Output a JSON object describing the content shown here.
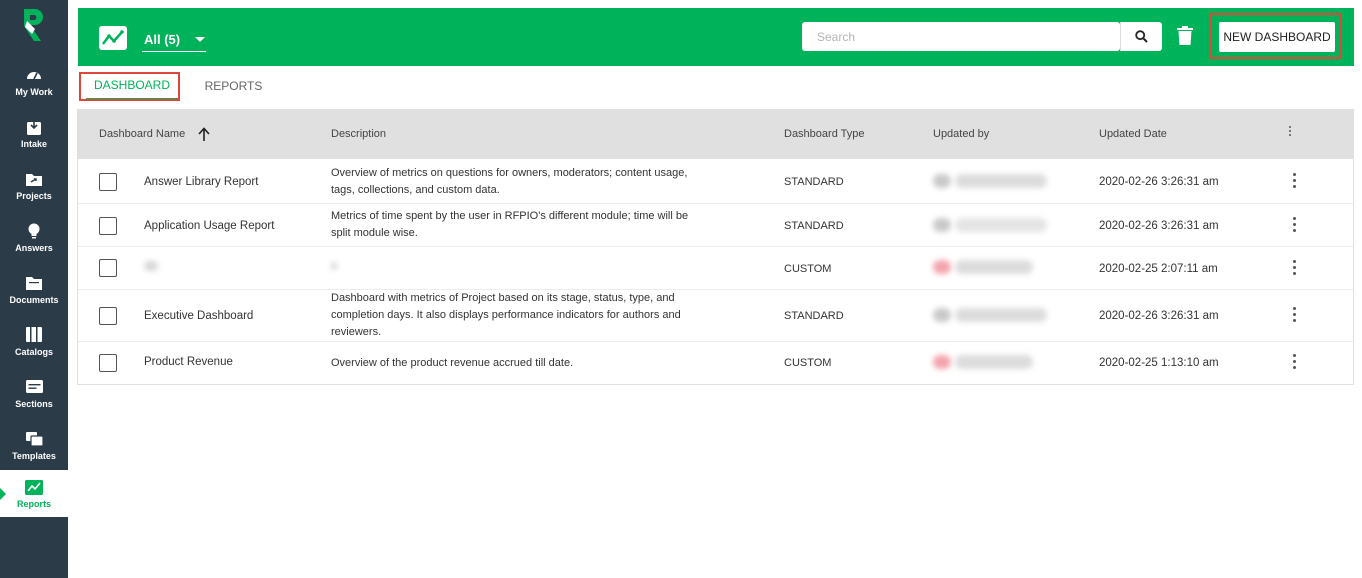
{
  "sidebar": {
    "items": [
      {
        "label": "My Work",
        "icon": "gauge-icon"
      },
      {
        "label": "Intake",
        "icon": "inbox-download-icon"
      },
      {
        "label": "Projects",
        "icon": "folder-share-icon"
      },
      {
        "label": "Answers",
        "icon": "lightbulb-icon"
      },
      {
        "label": "Documents",
        "icon": "folder-icon"
      },
      {
        "label": "Catalogs",
        "icon": "book-icon"
      },
      {
        "label": "Sections",
        "icon": "sections-icon"
      },
      {
        "label": "Templates",
        "icon": "templates-icon"
      },
      {
        "label": "Reports",
        "icon": "chart-line-icon"
      }
    ],
    "active": "Reports"
  },
  "header": {
    "filter_label": "All (5)",
    "search_placeholder": "Search",
    "new_button_label": "NEW DASHBOARD"
  },
  "tabs": [
    {
      "label": "DASHBOARD",
      "active": true
    },
    {
      "label": "REPORTS",
      "active": false
    }
  ],
  "table": {
    "columns": [
      "Dashboard Name",
      "Description",
      "Dashboard Type",
      "Updated by",
      "Updated Date"
    ],
    "rows": [
      {
        "name": "Answer Library Report",
        "description": "Overview of metrics on questions for owners, moderators; content usage, tags, collections, and custom data.",
        "type": "STANDARD",
        "updated_date": "2020-02-26  3:26:31 am"
      },
      {
        "name": "Application Usage Report",
        "description": "Metrics of time spent by the user in RFPIO's different module; time will be split module wise.",
        "type": "STANDARD",
        "updated_date": "2020-02-26  3:26:31 am"
      },
      {
        "name": "",
        "description": "",
        "type": "CUSTOM",
        "updated_date": "2020-02-25  2:07:11 am"
      },
      {
        "name": "Executive Dashboard",
        "description": "Dashboard with metrics of Project based on its stage, status, type, and completion days. It also displays performance indicators for authors and reviewers.",
        "type": "STANDARD",
        "updated_date": "2020-02-26  3:26:31 am"
      },
      {
        "name": "Product Revenue",
        "description": "Overview of the product revenue accrued till date.",
        "type": "CUSTOM",
        "updated_date": "2020-02-25  1:13:10 am"
      }
    ]
  },
  "colors": {
    "brand_green": "#00b25a",
    "sidebar_bg": "#2b3b48",
    "highlight_red": "#e0453a"
  }
}
